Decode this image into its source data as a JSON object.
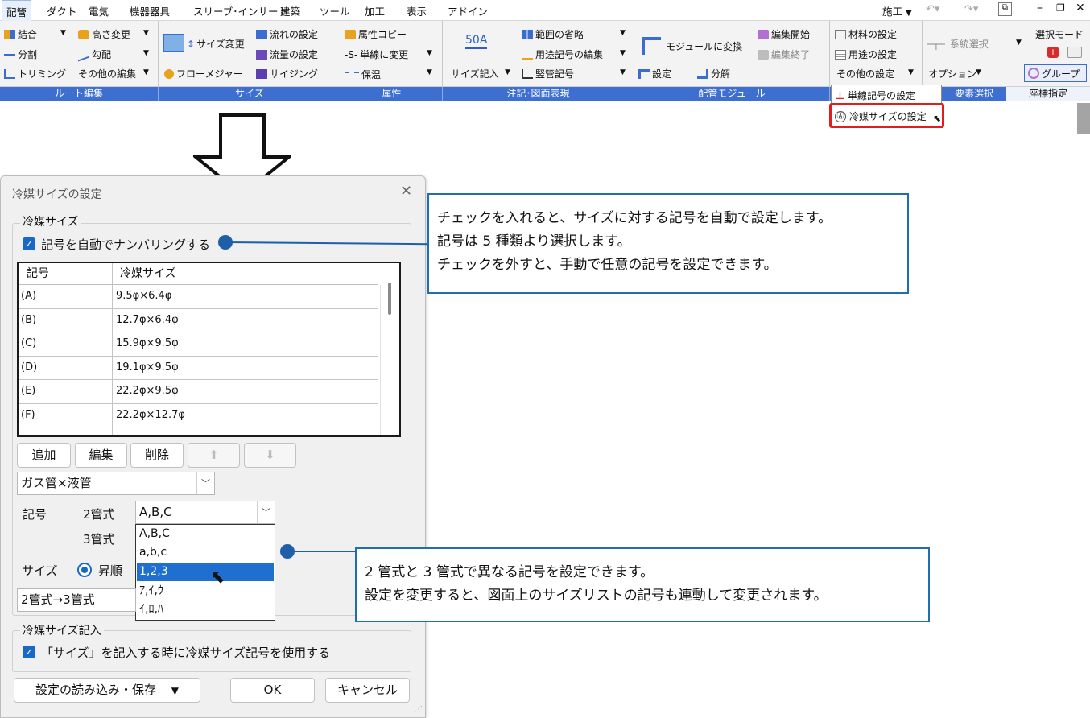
{
  "menubar": {
    "tabs": [
      "配管",
      "ダクト",
      "電気",
      "機器器具",
      "スリーブ･インサート",
      "建築",
      "ツール",
      "加工",
      "表示",
      "アドイン"
    ],
    "active_tab": "配管",
    "right_mode": "施工"
  },
  "ribbon": {
    "route_edit": {
      "items": [
        "結合",
        "分割",
        "トリミング",
        "高さ変更",
        "勾配",
        "その他の編集"
      ],
      "label": "ルート編集"
    },
    "size": {
      "items": [
        "サイズ変更",
        "フローメジャー",
        "流れの設定",
        "流量の設定",
        "サイジング"
      ],
      "label": "サイズ"
    },
    "attr": {
      "items": [
        "属性コピー",
        "単線に変更",
        "保温"
      ],
      "label": "属性"
    },
    "annotation": {
      "badge": "50A",
      "items": [
        "サイズ記入",
        "範囲の省略",
        "用途記号の編集",
        "竪管記号"
      ],
      "label": "注記･図面表現"
    },
    "module": {
      "items": [
        "モジュールに変換",
        "設定",
        "分解",
        "編集開始",
        "編集終了"
      ],
      "label": "配管モジュール"
    },
    "settings": {
      "items": [
        "材料の設定",
        "用途の設定",
        "その他の設定"
      ]
    },
    "select": {
      "items": [
        "系統選択",
        "オプション",
        "選択モード",
        "グループ"
      ],
      "labels": [
        "要素選択",
        "座標指定"
      ]
    }
  },
  "popup": {
    "item1": "単線記号の設定",
    "item2": "冷媒サイズの設定"
  },
  "dialog": {
    "title": "冷媒サイズの設定",
    "group1_legend": "冷媒サイズ",
    "auto_number_label": "記号を自動でナンバリングする",
    "table": {
      "headers": [
        "記号",
        "冷媒サイズ"
      ],
      "rows": [
        [
          "(A)",
          "9.5φ×6.4φ"
        ],
        [
          "(B)",
          "12.7φ×6.4φ"
        ],
        [
          "(C)",
          "15.9φ×9.5φ"
        ],
        [
          "(D)",
          "19.1φ×9.5φ"
        ],
        [
          "(E)",
          "22.2φ×9.5φ"
        ],
        [
          "(F)",
          "22.2φ×12.7φ"
        ]
      ]
    },
    "buttons": {
      "add": "追加",
      "edit": "編集",
      "delete": "削除",
      "up": "⬆",
      "down": "⬇"
    },
    "pipe_combo": "ガス管×液管",
    "symbol_label": "記号",
    "two_pipe_label": "2管式",
    "two_pipe_value": "A,B,C",
    "three_pipe_label": "3管式",
    "dropdown_options": [
      "A,B,C",
      "a,b,c",
      "1,2,3",
      "ｱ,ｲ,ｳ",
      "ｲ,ﾛ,ﾊ"
    ],
    "dropdown_selected_index": 2,
    "size_label": "サイズ",
    "sort_label": "昇順",
    "conversion_value": "2管式→3管式",
    "group2_legend": "冷媒サイズ記入",
    "use_symbol_label": "「サイズ」を記入する時に冷媒サイズ記号を使用する",
    "load_save": "設定の読み込み・保存",
    "ok": "OK",
    "cancel": "キャンセル"
  },
  "callouts": {
    "top": [
      "チェックを入れると、サイズに対する記号を自動で設定します。",
      "記号は 5 種類より選択します。",
      "チェックを外すと、手動で任意の記号を設定できます。"
    ],
    "bottom": [
      "2 管式と 3 管式で異なる記号を設定できます。",
      "設定を変更すると、図面上のサイズリストの記号も連動して変更されます。"
    ]
  },
  "colors": {
    "accent": "#1868c8",
    "callout_border": "#1f6fae",
    "group_bar": "#3d6fd1",
    "highlight": "#e11d1d"
  }
}
